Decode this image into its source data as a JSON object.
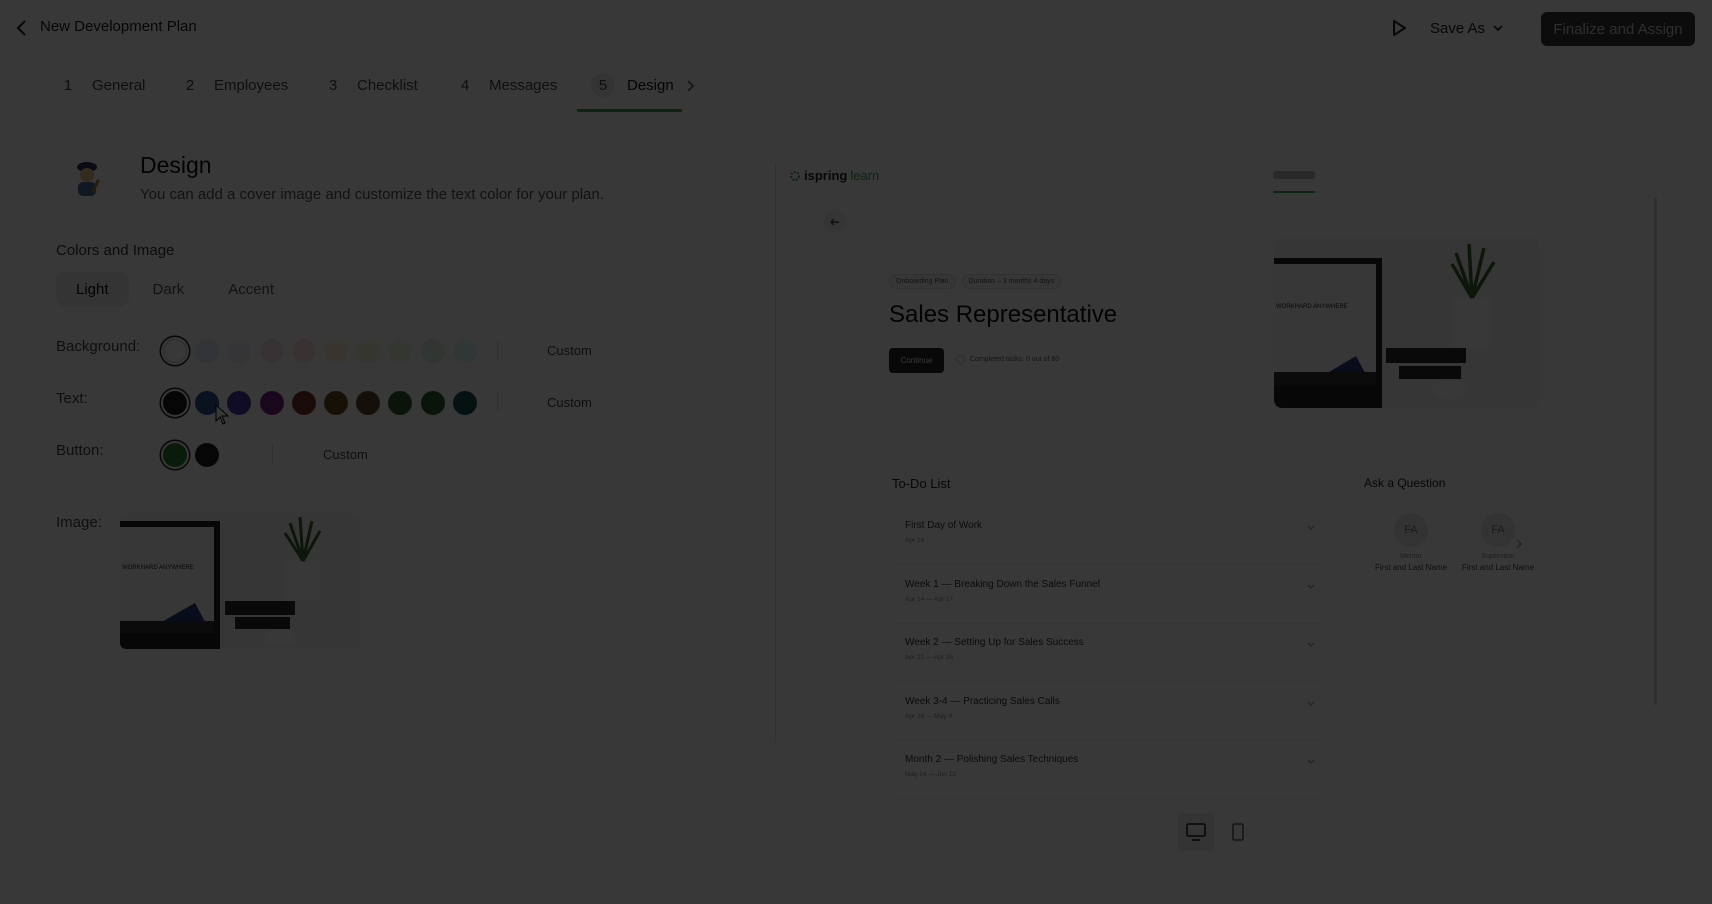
{
  "header": {
    "title": "New Development Plan",
    "save_as_label": "Save As",
    "finalize_label": "Finalize and Assign"
  },
  "tabs": [
    {
      "num": "1",
      "label": "General"
    },
    {
      "num": "2",
      "label": "Employees"
    },
    {
      "num": "3",
      "label": "Checklist"
    },
    {
      "num": "4",
      "label": "Messages"
    },
    {
      "num": "5",
      "label": "Design"
    }
  ],
  "design": {
    "title": "Design",
    "subtitle": "You can add a cover image and customize the text color for your plan.",
    "section_label": "Colors and Image",
    "theme_tabs": [
      "Light",
      "Dark",
      "Accent"
    ],
    "active_theme": "Light",
    "background_label": "Background:",
    "text_label": "Text:",
    "button_label": "Button:",
    "image_label": "Image:",
    "custom_label": "Custom",
    "background_colors": [
      "#ffffff",
      "#e6ecfb",
      "#efeaf9",
      "#fbe8f2",
      "#fce9e4",
      "#fdf0e0",
      "#f5f6dd",
      "#eaf3df",
      "#e2f4e6",
      "#e0f3f3"
    ],
    "text_colors": [
      "#1f1f1f",
      "#2f4d8f",
      "#4b3aa8",
      "#7d2283",
      "#7a3425",
      "#6b4a1e",
      "#5a4628",
      "#2f5c2e",
      "#2b5b2d",
      "#1e4d4f"
    ],
    "button_colors": [
      "#2e7d32",
      "#1f1f1f"
    ]
  },
  "preview": {
    "logo_text": "ispring",
    "logo_accent": "learn",
    "chips": [
      "Onboarding Plan",
      "Duration – 3 months 4 days"
    ],
    "title": "Sales Representative",
    "continue_label": "Continue",
    "progress_text": "Completed tasks: 0 out of 80",
    "todo_title": "To-Do List",
    "todo": [
      {
        "title": "First Day of Work",
        "date": "Apr 14"
      },
      {
        "title": "Week 1 — Breaking Down the Sales Funnel",
        "date": "Apr 14 — Apr 17"
      },
      {
        "title": "Week 2 — Setting Up for Sales Success",
        "date": "Apr 21 — Apr 25"
      },
      {
        "title": "Week 3-4 — Practicing Sales Calls",
        "date": "Apr 28 — May 9"
      },
      {
        "title": "Month 2 — Polishing Sales Techniques",
        "date": "May 14 — Jun 12"
      }
    ],
    "ask_title": "Ask a Question",
    "contacts": [
      {
        "initials": "FA",
        "role": "Mentor",
        "name": "First and Last Name"
      },
      {
        "initials": "FA",
        "role": "Supervisor",
        "name": "First and Last Name"
      }
    ],
    "cover_text": "WORKHARD ANYWHERE"
  },
  "colors": {
    "accent": "#3aa64a",
    "overlay": "rgba(0,0,0,0.78)"
  }
}
